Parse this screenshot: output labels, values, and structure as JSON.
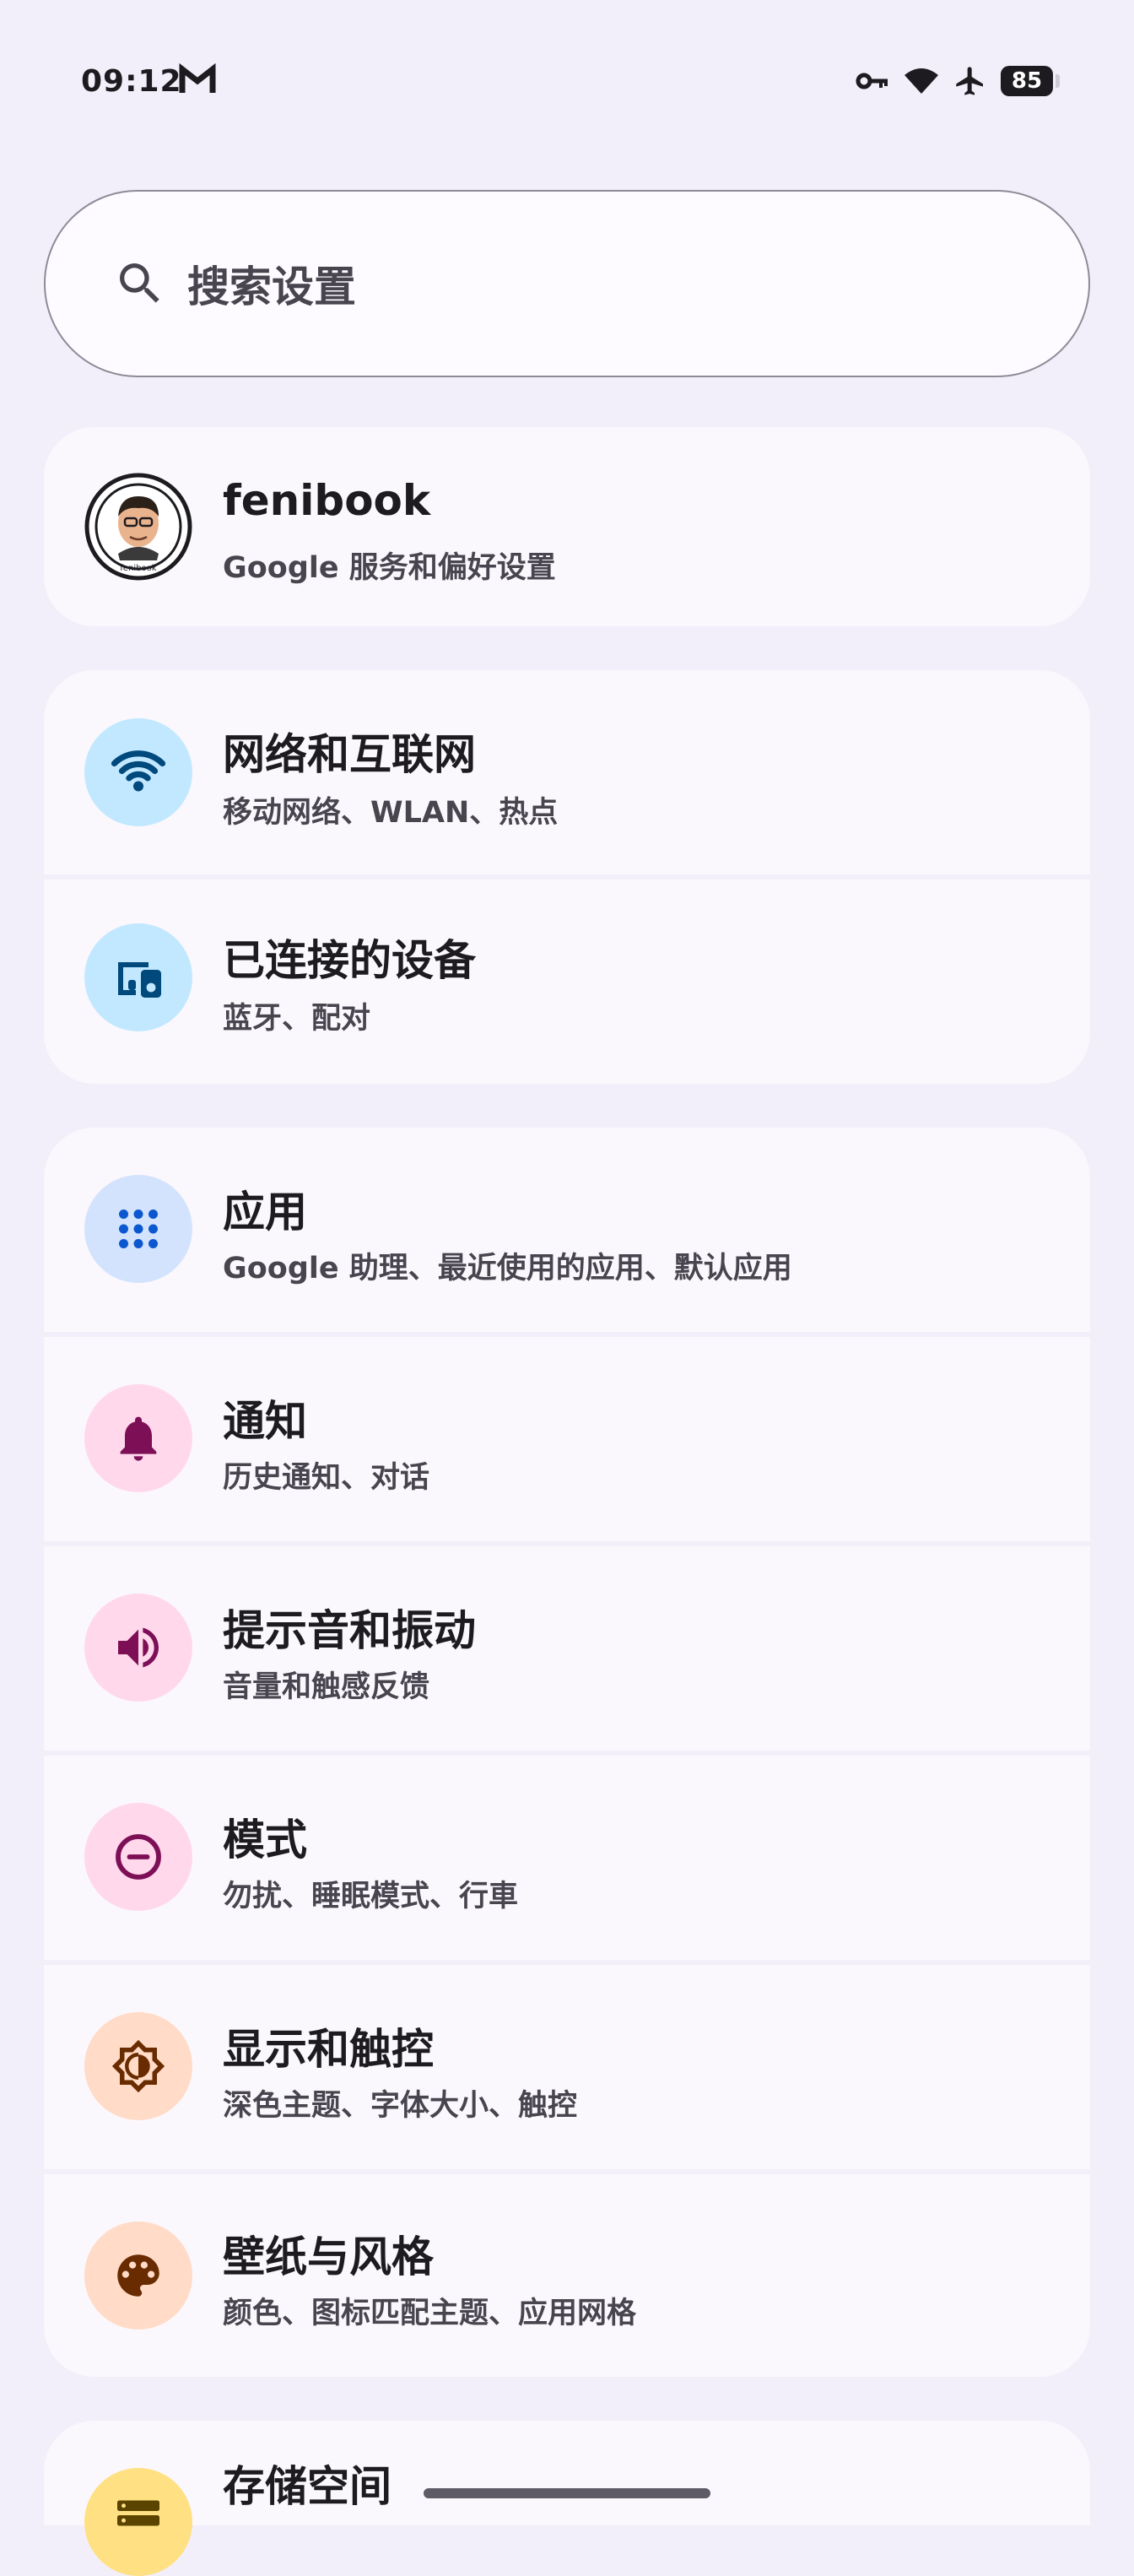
{
  "status_bar": {
    "time": "09:12",
    "battery": "85",
    "icons": [
      "gmail-icon",
      "key-icon",
      "wifi-icon",
      "airplane-icon",
      "battery-icon"
    ]
  },
  "search": {
    "placeholder": "搜索设置"
  },
  "account": {
    "name": "fenibook",
    "subtitle": "Google 服务和偏好设置",
    "avatar_caption": "fenibook"
  },
  "settings": [
    {
      "title": "网络和互联网",
      "subtitle": "移动网络、WLAN、热点",
      "icon": "wifi-icon",
      "bg": "#c2e8ff",
      "fg": "#00497d"
    },
    {
      "title": "已连接的设备",
      "subtitle": "蓝牙、配对",
      "icon": "devices-icon",
      "bg": "#c2e8ff",
      "fg": "#00497d"
    },
    {
      "title": "应用",
      "subtitle": "Google 助理、最近使用的应用、默认应用",
      "icon": "apps-icon",
      "bg": "#d3e3fd",
      "fg": "#0b57d0"
    },
    {
      "title": "通知",
      "subtitle": "历史通知、对话",
      "icon": "bell-icon",
      "bg": "#ffd8ec",
      "fg": "#7d0f57"
    },
    {
      "title": "提示音和振动",
      "subtitle": "音量和触感反馈",
      "icon": "volume-icon",
      "bg": "#ffd8ec",
      "fg": "#7d0f57"
    },
    {
      "title": "模式",
      "subtitle": "勿扰、睡眠模式、行車",
      "icon": "dnd-icon",
      "bg": "#ffd8ec",
      "fg": "#7d0f57"
    },
    {
      "title": "显示和触控",
      "subtitle": "深色主题、字体大小、触控",
      "icon": "brightness-icon",
      "bg": "#ffdbc8",
      "fg": "#692b00"
    },
    {
      "title": "壁纸与风格",
      "subtitle": "颜色、图标匹配主题、应用网格",
      "icon": "palette-icon",
      "bg": "#ffdbc8",
      "fg": "#692b00"
    },
    {
      "title": "存储空间",
      "subtitle": "",
      "icon": "storage-icon",
      "bg": "#ffe082",
      "fg": "#5b4300"
    }
  ]
}
